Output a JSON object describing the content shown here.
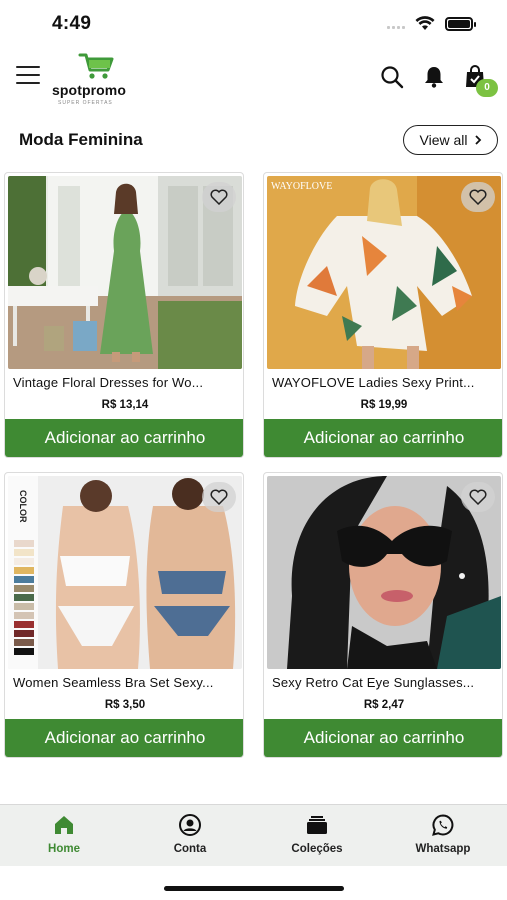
{
  "status_bar": {
    "time": "4:49"
  },
  "header": {
    "logo_name": "spotpromo",
    "logo_tagline": "SUPER OFERTAS",
    "cart_count": "0",
    "icons": [
      "menu-icon",
      "search-icon",
      "bell-icon",
      "cart-icon"
    ]
  },
  "section": {
    "title": "Moda Feminina",
    "view_all_label": "View all"
  },
  "products": [
    {
      "name": "Vintage Floral Dresses for Wo...",
      "price": "R$ 13,14",
      "button": "Adicionar ao carrinho"
    },
    {
      "name": "WAYOFLOVE Ladies Sexy Print...",
      "price": "R$ 19,99",
      "button": "Adicionar ao carrinho",
      "image_text": "WAYOFLOVE"
    },
    {
      "name": "Women Seamless Bra Set Sexy...",
      "price": "R$ 3,50",
      "button": "Adicionar ao carrinho",
      "image_text": "COLOR"
    },
    {
      "name": "Sexy Retro Cat Eye Sunglasses...",
      "price": "R$ 2,47",
      "button": "Adicionar ao carrinho"
    }
  ],
  "bottom_nav": [
    {
      "label": "Home",
      "icon": "home-icon",
      "active": true
    },
    {
      "label": "Conta",
      "icon": "user-icon",
      "active": false
    },
    {
      "label": "Coleções",
      "icon": "collections-icon",
      "active": false
    },
    {
      "label": "Whatsapp",
      "icon": "whatsapp-icon",
      "active": false
    }
  ],
  "colors": {
    "accent_green": "#3f8a33",
    "badge_green": "#7cc242",
    "nav_bg": "#eef0ee"
  }
}
